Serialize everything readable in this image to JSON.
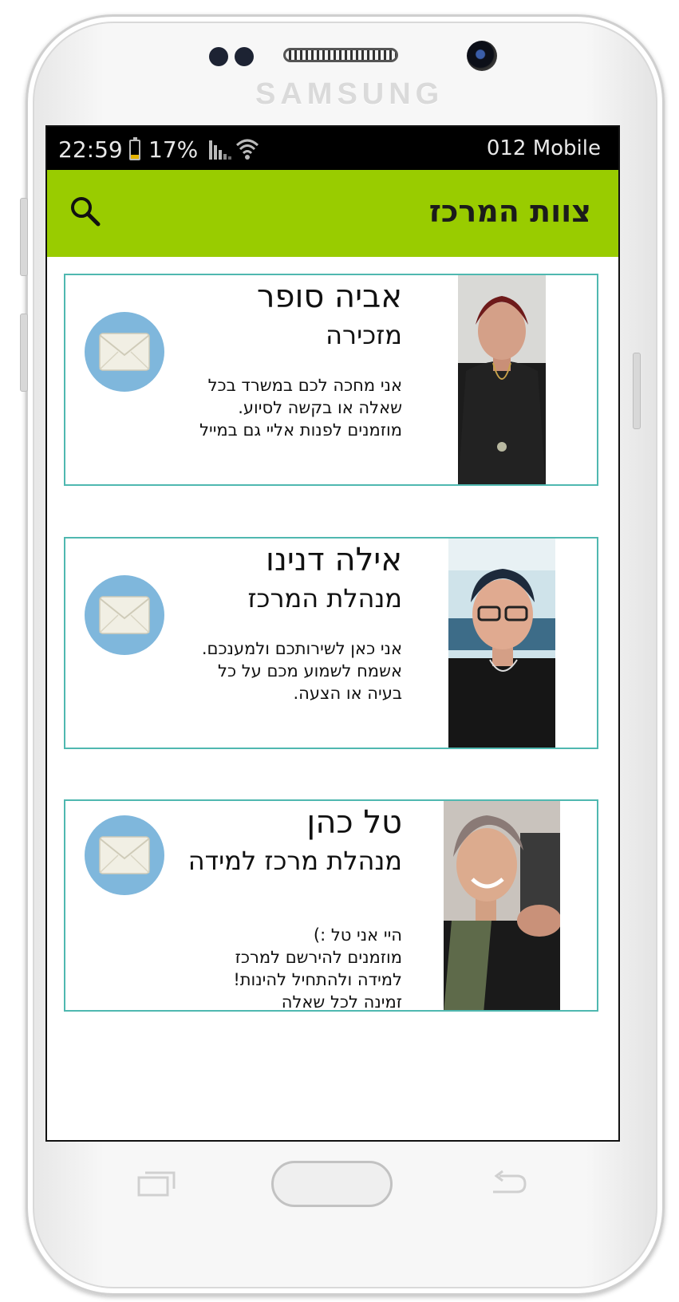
{
  "device": {
    "brand": "SAMSUNG"
  },
  "status_bar": {
    "time": "22:59",
    "battery": "17%",
    "carrier": "012 Mobile"
  },
  "app_bar": {
    "title": "צוות המרכז",
    "search_icon": "search-icon",
    "background_color": "#99cc00"
  },
  "accent_color": "#4fb8b0",
  "team": [
    {
      "name": "אביה סופר",
      "role": "מזכירה",
      "description": "אני מחכה לכם במשרד בכל שאלה או בקשה לסיוע.\nמוזמנים לפנות אליי גם במייל",
      "contact_icon": "mail-icon"
    },
    {
      "name": "אילה דנינו",
      "role": "מנהלת המרכז",
      "description": "אני כאן לשירותכם ולמענכם. אשמח לשמוע מכם על כל בעיה או הצעה.",
      "contact_icon": "mail-icon"
    },
    {
      "name": "טל כהן",
      "role": "מנהלת מרכז למידה",
      "description": "היי אני טל :)\nמוזמנים להירשם למרכז למידה ולהתחיל להינות!\nזמינה לכל שאלה",
      "contact_icon": "mail-icon"
    }
  ]
}
